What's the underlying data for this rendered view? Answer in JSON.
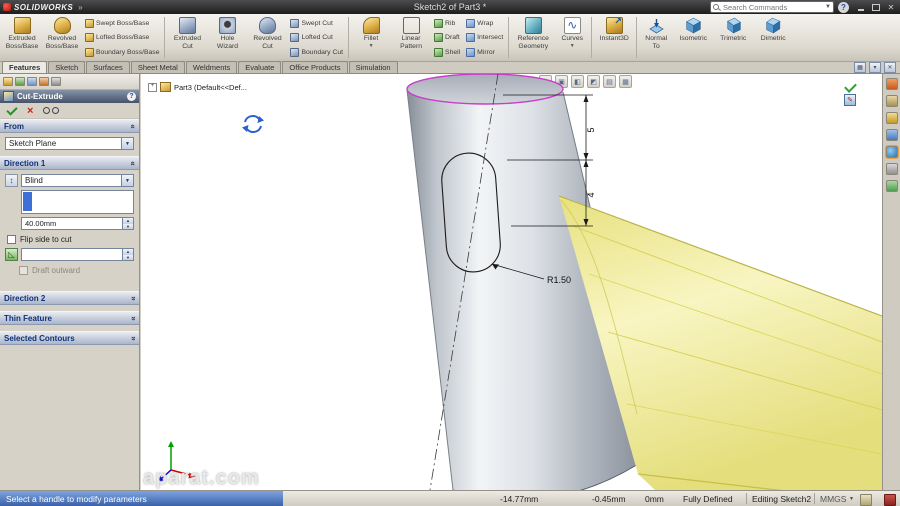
{
  "titlebar": {
    "logo_text": "SOLIDWORKS",
    "menu_arrow": "»",
    "doc_title": "Sketch2 of Part3 *",
    "search_placeholder": "Search Commands",
    "help_label": "?"
  },
  "ribbon": {
    "extruded_boss": {
      "l1": "Extruded",
      "l2": "Boss/Base"
    },
    "revolved_boss": {
      "l1": "Revolved",
      "l2": "Boss/Base"
    },
    "swept_boss": "Swept Boss/Base",
    "lofted_boss": "Lofted Boss/Base",
    "boundary_boss": "Boundary Boss/Base",
    "extruded_cut": {
      "l1": "Extruded",
      "l2": "Cut"
    },
    "hole_wizard": {
      "l1": "Hole",
      "l2": "Wizard"
    },
    "revolved_cut": {
      "l1": "Revolved",
      "l2": "Cut"
    },
    "swept_cut": "Swept Cut",
    "lofted_cut": "Lofted Cut",
    "boundary_cut": "Boundary Cut",
    "fillet": "Fillet",
    "linear_pattern": {
      "l1": "Linear",
      "l2": "Pattern"
    },
    "rib": "Rib",
    "draft": "Draft",
    "shell": "Shell",
    "wrap": "Wrap",
    "intersect": "Intersect",
    "mirror": "Mirror",
    "reference_geometry": {
      "l1": "Reference",
      "l2": "Geometry"
    },
    "curves": "Curves",
    "instant3d": "Instant3D",
    "normal_to": {
      "l1": "Normal",
      "l2": "To"
    },
    "isometric": "Isometric",
    "trimetric": "Trimetric",
    "dimetric": "Dimetric"
  },
  "tabs": {
    "items": [
      "Features",
      "Sketch",
      "Surfaces",
      "Sheet Metal",
      "Weldments",
      "Evaluate",
      "Office Products",
      "Simulation"
    ],
    "active": "Features"
  },
  "pm": {
    "title": "Cut-Extrude",
    "help_label": "?",
    "from_header": "From",
    "from_plane": "Sketch Plane",
    "dir1_header": "Direction 1",
    "end_condition": "Blind",
    "depth_value": "40.00mm",
    "flip_label": "Flip side to cut",
    "draft_outward_label": "Draft outward",
    "dir2_header": "Direction 2",
    "thin_header": "Thin Feature",
    "contours_header": "Selected Contours"
  },
  "tree": {
    "root_label": "Part3 (Default<<Def..."
  },
  "viewport": {
    "dim_a": "5",
    "dim_b": "4",
    "radius_label": "R1.50",
    "watermark": "aparat.com"
  },
  "statusbar": {
    "message": "Select a handle to modify parameters",
    "coord_x": "-14.77mm",
    "coord_y": "-0.45mm",
    "coord_z": "0mm",
    "define_state": "Fully Defined",
    "edit_state": "Editing Sketch2",
    "units": "MMGS"
  },
  "colors": {
    "sketch_magenta": "#c93ec9",
    "preview_yellow": "#f3f0a8",
    "selection_blue": "#3d6fd6"
  }
}
